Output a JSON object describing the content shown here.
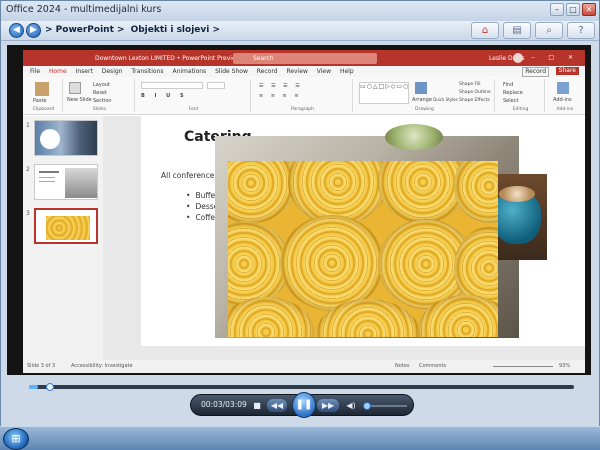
{
  "window": {
    "title": "Office 2024 - multimedijalni kurs",
    "btn_min": "–",
    "btn_max": "□",
    "btn_close": "✕"
  },
  "nav": {
    "back": "◀",
    "forward": "▶",
    "crumbs": [
      "> PowerPoint >",
      "Objekti i slojevi >"
    ],
    "tools": [
      "home-icon",
      "print-icon",
      "search-icon",
      "help-icon"
    ]
  },
  "ppt": {
    "doc_title": "Downtown Lexton LIMITED • PowerPoint Preview",
    "search_placeholder": "Search",
    "user": "Leslie Davis",
    "menus": [
      "File",
      "Home",
      "Insert",
      "Design",
      "Transitions",
      "Animations",
      "Slide Show",
      "Record",
      "Review",
      "View",
      "Help"
    ],
    "active_menu": "Home",
    "record_label": "Record",
    "share_label": "Share",
    "ribbon_groups": [
      "Clipboard",
      "Slides",
      "Font",
      "Paragraph",
      "Drawing",
      "Editing",
      "Add-ins"
    ],
    "ribbon_items": {
      "paste": "Paste",
      "new_slide": "New Slide",
      "layout": "Layout",
      "reset": "Reset",
      "section": "Section",
      "arrange": "Arrange",
      "quick_styles": "Quick Styles",
      "shape_fill": "Shape Fill",
      "shape_outline": "Shape Outline",
      "shape_effects": "Shape Effects",
      "find": "Find",
      "replace": "Replace",
      "select": "Select",
      "addins": "Add-ins"
    },
    "slide_numbers": [
      "1",
      "2",
      "3"
    ],
    "slide": {
      "heading": "Catering",
      "body": "All conference a",
      "bullets": [
        "Buffet sty",
        "Dessert b",
        "Coffee an"
      ]
    },
    "status": {
      "slide_of": "Slide 3 of 3",
      "accessibility": "Accessibility: Investigate",
      "notes": "Notes",
      "comments": "Comments",
      "zoom": "93%"
    }
  },
  "player": {
    "time": "00:03/03:09",
    "progress": 0.016,
    "volume": 0.0,
    "icons": [
      "stop-icon",
      "rewind-icon",
      "pause-icon",
      "fast-forward-icon",
      "volume-icon"
    ]
  },
  "taskbar": {
    "start": "⊞"
  }
}
